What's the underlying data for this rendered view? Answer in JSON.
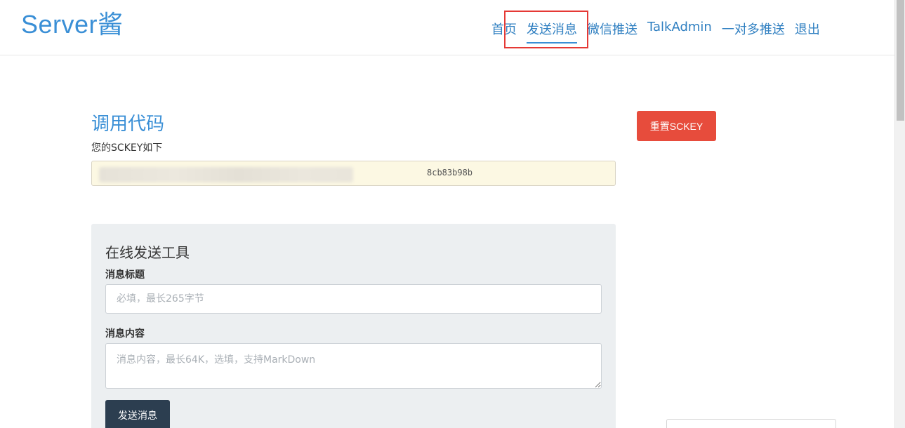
{
  "header": {
    "brand": "Server酱",
    "nav": [
      {
        "label": "首页",
        "active": false
      },
      {
        "label": "发送消息",
        "active": true
      },
      {
        "label": "微信推送",
        "active": false
      },
      {
        "label": "TalkAdmin",
        "active": false
      },
      {
        "label": "一对多推送",
        "active": false
      },
      {
        "label": "退出",
        "active": false
      }
    ]
  },
  "code_section": {
    "title": "调用代码",
    "sckey_label": "您的SCKEY如下",
    "sckey_visible_tail": "8cb83b98b",
    "reset_button": "重置SCKEY"
  },
  "tool": {
    "title": "在线发送工具",
    "title_label": "消息标题",
    "title_placeholder": "必填，最长265字节",
    "content_label": "消息内容",
    "content_placeholder": "消息内容，最长64K，选填，支持MarkDown",
    "send_button": "发送消息"
  },
  "colors": {
    "brand": "#3a8fd6",
    "reset": "#e74c3c",
    "send": "#2c3e50",
    "highlight": "#e53935"
  }
}
